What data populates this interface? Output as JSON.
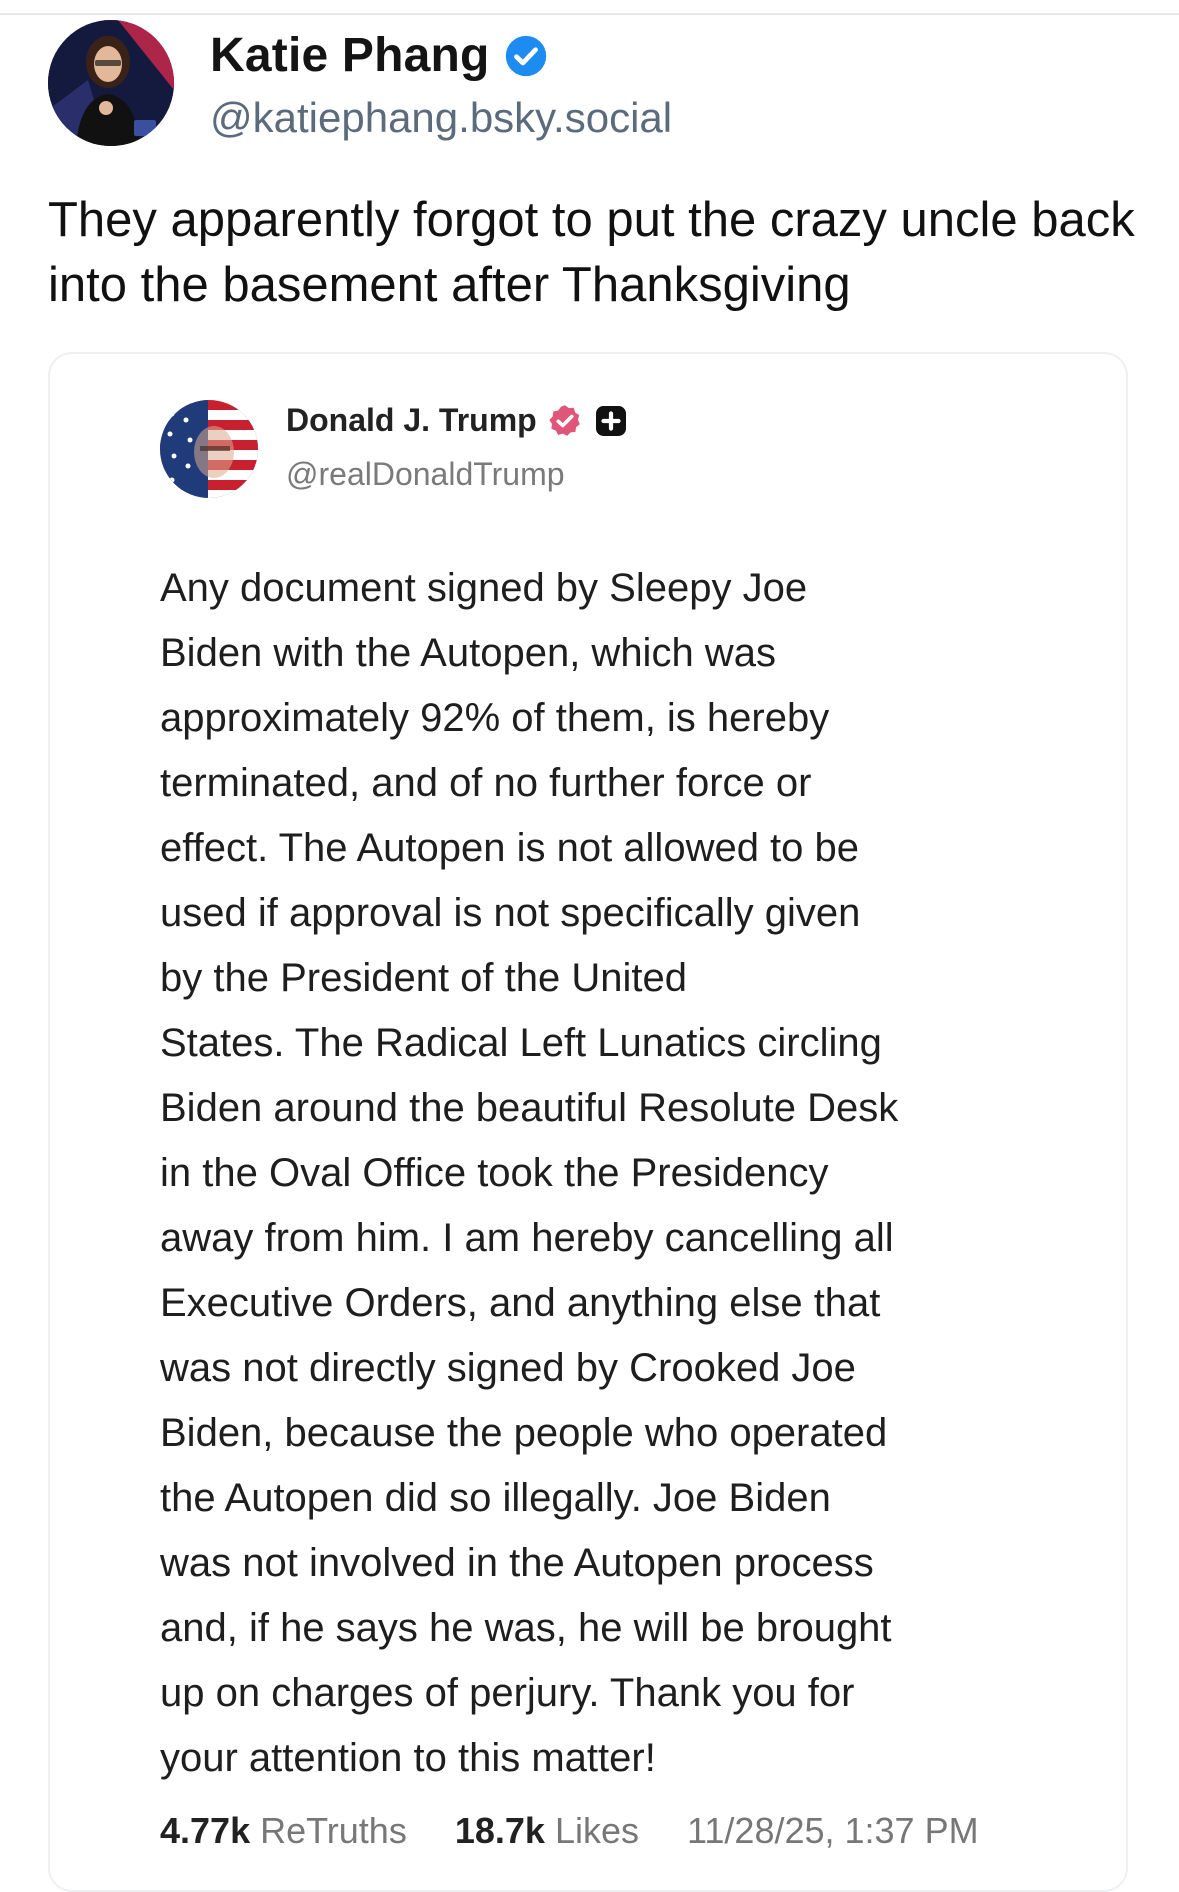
{
  "post": {
    "author": {
      "name": "Katie Phang",
      "handle": "@katiephang.bsky.social",
      "verified_icon": "verified-check-icon",
      "verified_color": "#1d8cf0"
    },
    "text": "They apparently forgot to put the crazy uncle back into the basement after Thanksgiving"
  },
  "embed": {
    "author": {
      "name": "Donald J. Trump",
      "handle": "@realDonaldTrump",
      "badge_icon": "verified-badge-icon",
      "badge_color": "#e0567a",
      "extra_icon": "plus-square-icon"
    },
    "lines": [
      "Any document signed by Sleepy Joe",
      "Biden with the Autopen, which was",
      "approximately 92% of them, is hereby",
      "terminated, and of no further force or",
      "effect. The Autopen is not allowed to be",
      "used if approval is not specifically given",
      "by the President of the United",
      "States. The Radical Left Lunatics circling",
      "Biden around the beautiful Resolute Desk",
      "in the Oval Office took the Presidency",
      "away from him. I am hereby cancelling all",
      "Executive Orders, and anything else that",
      "was not directly signed by Crooked Joe",
      "Biden, because the people who operated",
      "the Autopen did so illegally. Joe Biden",
      "was not involved in the Autopen process",
      "and, if he says he was, he will be brought",
      "up on charges of perjury. Thank you for",
      "your attention to this matter!"
    ],
    "stats": {
      "retruths_count": "4.77k",
      "retruths_label": "ReTruths",
      "likes_count": "18.7k",
      "likes_label": "Likes",
      "timestamp": "11/28/25, 1:37 PM"
    }
  }
}
